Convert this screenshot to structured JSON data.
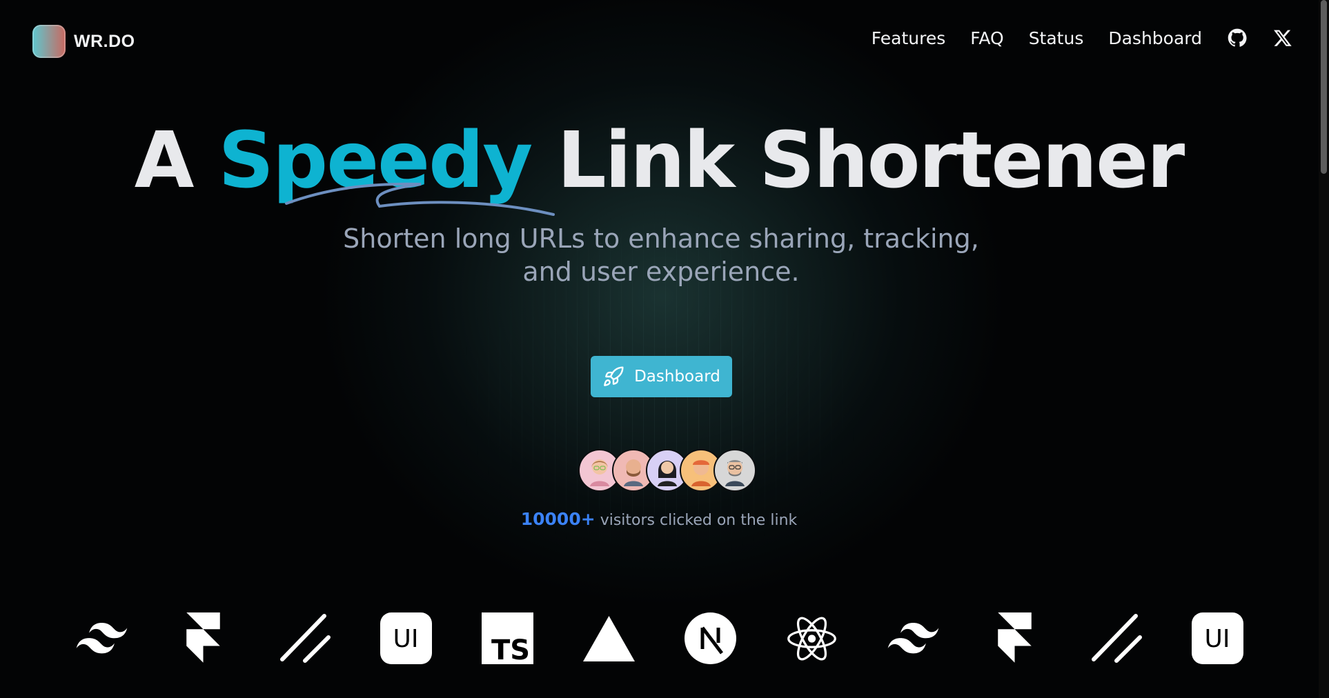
{
  "brand": {
    "name": "WR.DO"
  },
  "nav": {
    "items": [
      "Features",
      "FAQ",
      "Status",
      "Dashboard"
    ],
    "github_icon": "github-icon",
    "x_icon": "x-icon"
  },
  "hero": {
    "headline_prefix": "A",
    "headline_accent": "Speedy",
    "headline_suffix": "Link Shortener",
    "subtitle": "Shorten long URLs to enhance sharing, tracking, and user experience.",
    "cta_label": "Dashboard",
    "cta_icon": "rocket-icon"
  },
  "social_proof": {
    "count": "10000+",
    "text": "visitors clicked on the link",
    "avatars": [
      "avatar-1",
      "avatar-2",
      "avatar-3",
      "avatar-4",
      "avatar-5"
    ]
  },
  "tech_logos": [
    "tailwind-icon",
    "framer-icon",
    "shadcn-icon",
    "ui-icon",
    "typescript-icon",
    "vercel-icon",
    "nextjs-icon",
    "react-icon",
    "tailwind-icon",
    "framer-icon",
    "shadcn-icon",
    "ui-icon"
  ],
  "colors": {
    "accent": "#0eb3d1",
    "cta": "#3fb5d1",
    "count": "#3b82f6",
    "background": "#030405"
  }
}
